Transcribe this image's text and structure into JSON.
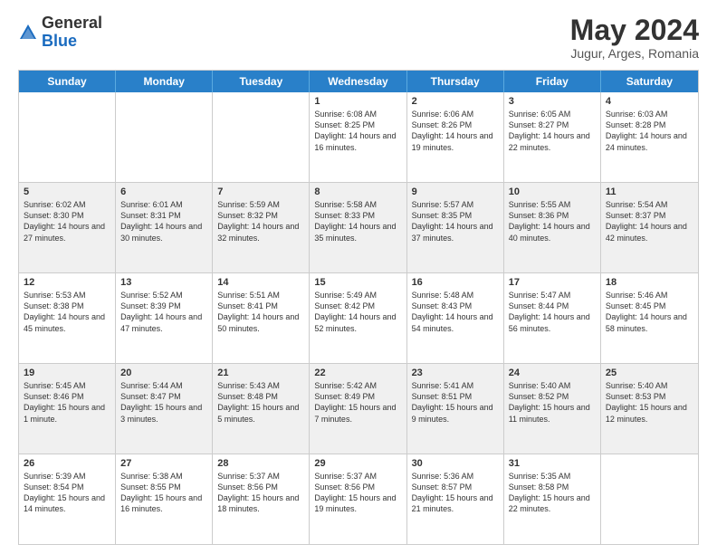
{
  "header": {
    "logo_general": "General",
    "logo_blue": "Blue",
    "month_title": "May 2024",
    "subtitle": "Jugur, Arges, Romania"
  },
  "calendar": {
    "days": [
      "Sunday",
      "Monday",
      "Tuesday",
      "Wednesday",
      "Thursday",
      "Friday",
      "Saturday"
    ],
    "rows": [
      [
        {
          "day": "",
          "text": ""
        },
        {
          "day": "",
          "text": ""
        },
        {
          "day": "",
          "text": ""
        },
        {
          "day": "1",
          "text": "Sunrise: 6:08 AM\nSunset: 8:25 PM\nDaylight: 14 hours and 16 minutes."
        },
        {
          "day": "2",
          "text": "Sunrise: 6:06 AM\nSunset: 8:26 PM\nDaylight: 14 hours and 19 minutes."
        },
        {
          "day": "3",
          "text": "Sunrise: 6:05 AM\nSunset: 8:27 PM\nDaylight: 14 hours and 22 minutes."
        },
        {
          "day": "4",
          "text": "Sunrise: 6:03 AM\nSunset: 8:28 PM\nDaylight: 14 hours and 24 minutes."
        }
      ],
      [
        {
          "day": "5",
          "text": "Sunrise: 6:02 AM\nSunset: 8:30 PM\nDaylight: 14 hours and 27 minutes."
        },
        {
          "day": "6",
          "text": "Sunrise: 6:01 AM\nSunset: 8:31 PM\nDaylight: 14 hours and 30 minutes."
        },
        {
          "day": "7",
          "text": "Sunrise: 5:59 AM\nSunset: 8:32 PM\nDaylight: 14 hours and 32 minutes."
        },
        {
          "day": "8",
          "text": "Sunrise: 5:58 AM\nSunset: 8:33 PM\nDaylight: 14 hours and 35 minutes."
        },
        {
          "day": "9",
          "text": "Sunrise: 5:57 AM\nSunset: 8:35 PM\nDaylight: 14 hours and 37 minutes."
        },
        {
          "day": "10",
          "text": "Sunrise: 5:55 AM\nSunset: 8:36 PM\nDaylight: 14 hours and 40 minutes."
        },
        {
          "day": "11",
          "text": "Sunrise: 5:54 AM\nSunset: 8:37 PM\nDaylight: 14 hours and 42 minutes."
        }
      ],
      [
        {
          "day": "12",
          "text": "Sunrise: 5:53 AM\nSunset: 8:38 PM\nDaylight: 14 hours and 45 minutes."
        },
        {
          "day": "13",
          "text": "Sunrise: 5:52 AM\nSunset: 8:39 PM\nDaylight: 14 hours and 47 minutes."
        },
        {
          "day": "14",
          "text": "Sunrise: 5:51 AM\nSunset: 8:41 PM\nDaylight: 14 hours and 50 minutes."
        },
        {
          "day": "15",
          "text": "Sunrise: 5:49 AM\nSunset: 8:42 PM\nDaylight: 14 hours and 52 minutes."
        },
        {
          "day": "16",
          "text": "Sunrise: 5:48 AM\nSunset: 8:43 PM\nDaylight: 14 hours and 54 minutes."
        },
        {
          "day": "17",
          "text": "Sunrise: 5:47 AM\nSunset: 8:44 PM\nDaylight: 14 hours and 56 minutes."
        },
        {
          "day": "18",
          "text": "Sunrise: 5:46 AM\nSunset: 8:45 PM\nDaylight: 14 hours and 58 minutes."
        }
      ],
      [
        {
          "day": "19",
          "text": "Sunrise: 5:45 AM\nSunset: 8:46 PM\nDaylight: 15 hours and 1 minute."
        },
        {
          "day": "20",
          "text": "Sunrise: 5:44 AM\nSunset: 8:47 PM\nDaylight: 15 hours and 3 minutes."
        },
        {
          "day": "21",
          "text": "Sunrise: 5:43 AM\nSunset: 8:48 PM\nDaylight: 15 hours and 5 minutes."
        },
        {
          "day": "22",
          "text": "Sunrise: 5:42 AM\nSunset: 8:49 PM\nDaylight: 15 hours and 7 minutes."
        },
        {
          "day": "23",
          "text": "Sunrise: 5:41 AM\nSunset: 8:51 PM\nDaylight: 15 hours and 9 minutes."
        },
        {
          "day": "24",
          "text": "Sunrise: 5:40 AM\nSunset: 8:52 PM\nDaylight: 15 hours and 11 minutes."
        },
        {
          "day": "25",
          "text": "Sunrise: 5:40 AM\nSunset: 8:53 PM\nDaylight: 15 hours and 12 minutes."
        }
      ],
      [
        {
          "day": "26",
          "text": "Sunrise: 5:39 AM\nSunset: 8:54 PM\nDaylight: 15 hours and 14 minutes."
        },
        {
          "day": "27",
          "text": "Sunrise: 5:38 AM\nSunset: 8:55 PM\nDaylight: 15 hours and 16 minutes."
        },
        {
          "day": "28",
          "text": "Sunrise: 5:37 AM\nSunset: 8:56 PM\nDaylight: 15 hours and 18 minutes."
        },
        {
          "day": "29",
          "text": "Sunrise: 5:37 AM\nSunset: 8:56 PM\nDaylight: 15 hours and 19 minutes."
        },
        {
          "day": "30",
          "text": "Sunrise: 5:36 AM\nSunset: 8:57 PM\nDaylight: 15 hours and 21 minutes."
        },
        {
          "day": "31",
          "text": "Sunrise: 5:35 AM\nSunset: 8:58 PM\nDaylight: 15 hours and 22 minutes."
        },
        {
          "day": "",
          "text": ""
        }
      ]
    ]
  }
}
